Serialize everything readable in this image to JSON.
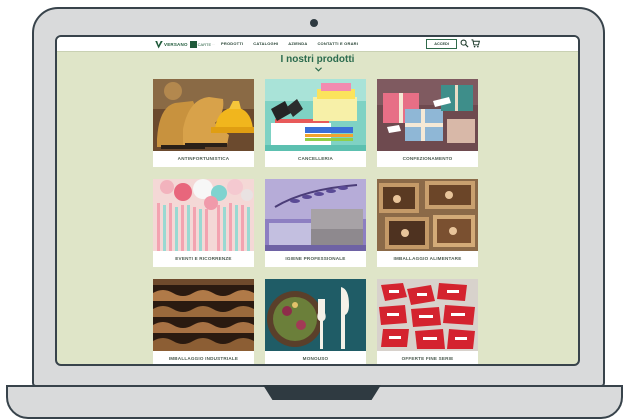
{
  "site": {
    "logo_word_1": "VERSANO",
    "logo_word_2": "CARTE",
    "logo_sub": "…"
  },
  "nav": {
    "items": [
      "PRODOTTI",
      "CATALOGHI",
      "AZIENDA",
      "CONTATTI E ORARI"
    ],
    "login": "ACCEDI",
    "icons": [
      "search-icon",
      "cart-icon"
    ]
  },
  "main": {
    "title": "I nostri prodotti",
    "categories": [
      {
        "label": "ANTINFORTUNISTICA",
        "image": "work-boots-and-hard-hat"
      },
      {
        "label": "CANCELLERIA",
        "image": "stationery-and-binder-clips"
      },
      {
        "label": "CONFEZIONAMENTO",
        "image": "gift-boxes-with-tags"
      },
      {
        "label": "EVENTI E RICORRENZE",
        "image": "pastel-balloons-and-streamers"
      },
      {
        "label": "IGIENE PROFESSIONALE",
        "image": "lavender-soap-and-towels"
      },
      {
        "label": "IMBALLAGGIO ALIMENTARE",
        "image": "kraft-pastry-boxes"
      },
      {
        "label": "IMBALLAGGIO INDUSTRIALE",
        "image": "corrugated-cardboard"
      },
      {
        "label": "MONOUSO",
        "image": "disposable-cutlery-and-salad"
      },
      {
        "label": "OFFERTE FINE SERIE",
        "image": "red-discount-tags"
      }
    ]
  },
  "colors": {
    "page_background": "#dfe5c8",
    "accent_green": "#2b6b4e",
    "frame": "#38434b"
  }
}
